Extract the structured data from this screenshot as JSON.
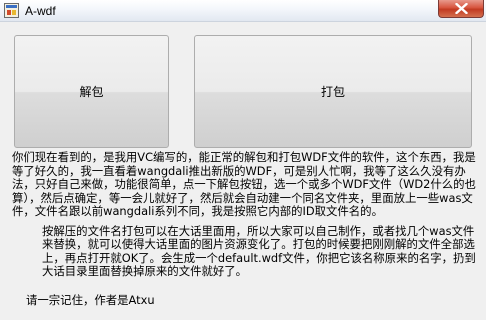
{
  "window": {
    "title": "A-wdf",
    "icon": "app-icon",
    "close_icon": "close-icon",
    "close_color": "#c23a22"
  },
  "buttons": {
    "unpack_label": "解包",
    "pack_label": "打包"
  },
  "description": {
    "paragraph1": "你们现在看到的，是我用VC编写的，能正常的解包和打包WDF文件的软件，这个东西，我是等了好久的，我一直看着wangdali推出新版的WDF，可是别人忙啊，我等了这么久没有办法，只好自己来做，功能很简单，点一下解包按钮，选一个或多个WDF文件（WD2什么的也算），然后点确定，等一会儿就好了，然后就会自动建一个同名文件夹，里面放上一些was文件，文件名跟以前wangdali系列不同，我是按照它内部的ID取文件名的。",
    "paragraph2": "按解压的文件名打包可以在大话里面用，所以大家可以自己制作，或者找几个was文件来替换，就可以使得大话里面的图片资源变化了。打包的时候要把刚刚解的文件全部选上，再点打开就OK了。会生成一个default.wdf文件，你把它该名称原来的名字，扔到大话目录里面替换掉原来的文件就好了。",
    "paragraph3": "请一宗记住，作者是Atxu"
  }
}
